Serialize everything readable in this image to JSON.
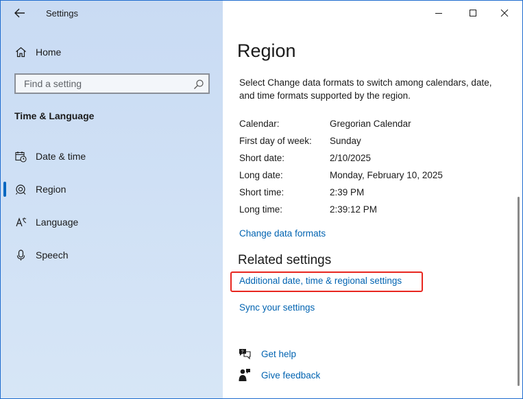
{
  "window": {
    "title": "Settings",
    "controls": {
      "minimize": "minimize",
      "maximize": "maximize",
      "close": "close"
    }
  },
  "sidebar": {
    "home_label": "Home",
    "search": {
      "placeholder": "Find a setting",
      "value": ""
    },
    "section_title": "Time & Language",
    "items": [
      {
        "label": "Date & time",
        "icon": "calendar-clock-icon",
        "selected": false
      },
      {
        "label": "Region",
        "icon": "globe-icon",
        "selected": true
      },
      {
        "label": "Language",
        "icon": "language-icon",
        "selected": false
      },
      {
        "label": "Speech",
        "icon": "microphone-icon",
        "selected": false
      }
    ]
  },
  "main": {
    "title": "Region",
    "description": "Select Change data formats to switch among calendars, date, and time formats supported by the region.",
    "formats": [
      {
        "key": "Calendar:",
        "value": "Gregorian Calendar"
      },
      {
        "key": "First day of week:",
        "value": "Sunday"
      },
      {
        "key": "Short date:",
        "value": "2/10/2025"
      },
      {
        "key": "Long date:",
        "value": "Monday, February 10, 2025"
      },
      {
        "key": "Short time:",
        "value": "2:39 PM"
      },
      {
        "key": "Long time:",
        "value": "2:39:12 PM"
      }
    ],
    "change_formats_link": "Change data formats",
    "related_title": "Related settings",
    "related_links": [
      "Additional date, time & regional settings",
      "Sync your settings"
    ],
    "help": [
      {
        "label": "Get help",
        "icon": "help-chat-icon"
      },
      {
        "label": "Give feedback",
        "icon": "feedback-icon"
      }
    ]
  },
  "colors": {
    "accent": "#0067c0",
    "link": "#0063b1",
    "highlight_border": "#e8261f",
    "window_border": "#1e6ccf"
  }
}
